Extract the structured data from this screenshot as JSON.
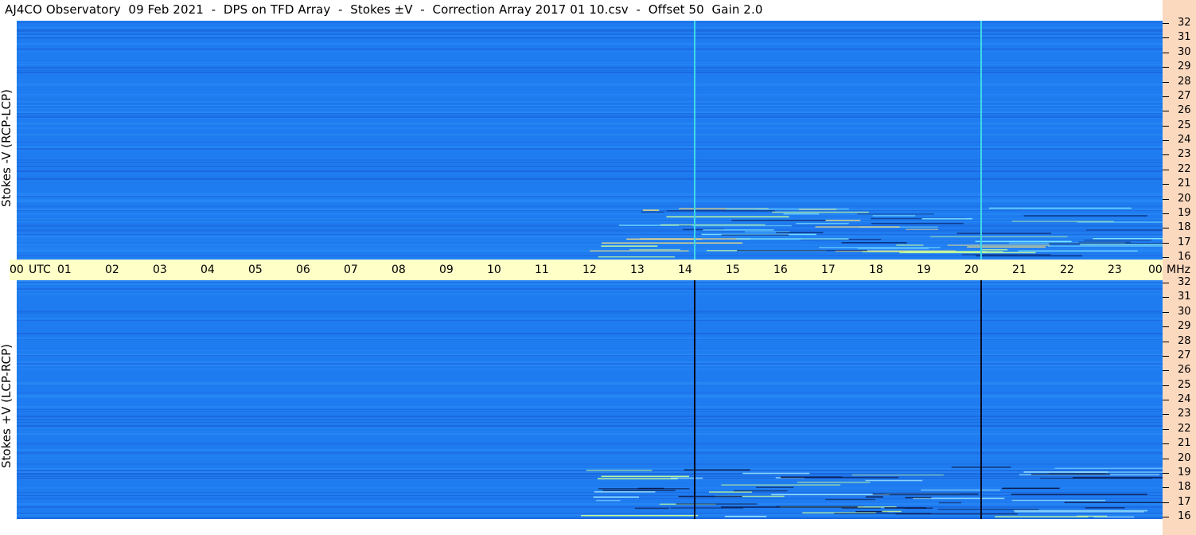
{
  "title": "AJ4CO Observatory  09 Feb 2021  -  DPS on TFD Array  -  Stokes ±V  -  Correction Array 2017 01 10.csv  -  Offset 50  Gain 2.0",
  "chart_data": [
    {
      "type": "heatmap",
      "panel": "top",
      "ylabel": "Stokes -V (RCP-LCP)",
      "x_ticks": [
        "00",
        "01",
        "02",
        "03",
        "04",
        "05",
        "06",
        "07",
        "08",
        "09",
        "10",
        "11",
        "12",
        "13",
        "14",
        "15",
        "16",
        "17",
        "18",
        "19",
        "20",
        "21",
        "22",
        "23",
        "00"
      ],
      "x_unit": "UTC",
      "y_ticks": [
        32,
        31,
        30,
        29,
        28,
        27,
        26,
        25,
        24,
        23,
        22,
        21,
        20,
        19,
        18,
        17,
        16
      ],
      "y_unit": "MHz",
      "ylim": [
        16,
        32
      ],
      "xlim": [
        0,
        24
      ],
      "vertical_lines_utc": [
        14.2,
        20.2
      ],
      "vertical_line_color": "#3fd8e8"
    },
    {
      "type": "heatmap",
      "panel": "bottom",
      "ylabel": "Stokes +V (LCP-RCP)",
      "x_ticks": [
        "00",
        "01",
        "02",
        "03",
        "04",
        "05",
        "06",
        "07",
        "08",
        "09",
        "10",
        "11",
        "12",
        "13",
        "14",
        "15",
        "16",
        "17",
        "18",
        "19",
        "20",
        "21",
        "22",
        "23",
        "00"
      ],
      "x_unit": "UTC",
      "y_ticks": [
        32,
        31,
        30,
        29,
        28,
        27,
        26,
        25,
        24,
        23,
        22,
        21,
        20,
        19,
        18,
        17,
        16
      ],
      "y_unit": "MHz",
      "ylim": [
        16,
        32
      ],
      "xlim": [
        0,
        24
      ],
      "vertical_lines_utc": [
        14.2,
        20.2
      ],
      "vertical_line_color": "#0a0a20"
    }
  ],
  "colors": {
    "panel_base": "#1f7cf0",
    "panel_dark": "#1a5fd6",
    "time_axis_bg": "#ffffc8",
    "freq_axis_bg": "#fbd9bf"
  }
}
